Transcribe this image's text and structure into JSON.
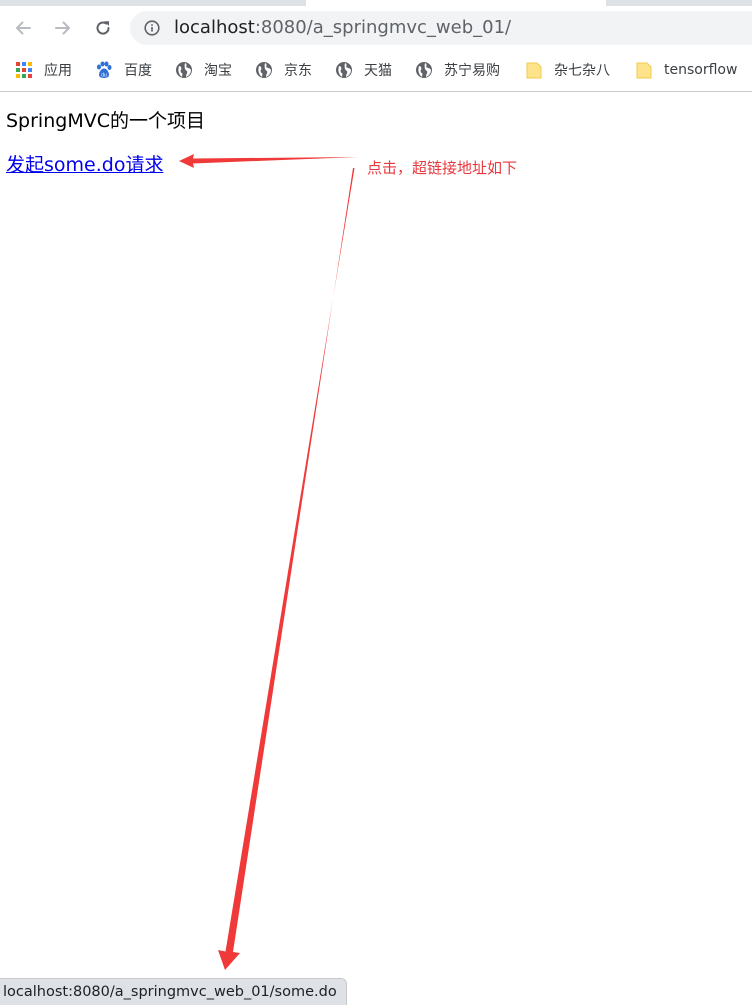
{
  "browser": {
    "url_host": "localhost",
    "url_rest": ":8080/a_springmvc_web_01/",
    "bookmarks": [
      {
        "label": "应用",
        "icon": "apps-grid-icon"
      },
      {
        "label": "百度",
        "icon": "baidu-paw-icon"
      },
      {
        "label": "淘宝",
        "icon": "globe-icon"
      },
      {
        "label": "京东",
        "icon": "globe-icon"
      },
      {
        "label": "天猫",
        "icon": "globe-icon"
      },
      {
        "label": "苏宁易购",
        "icon": "globe-icon"
      },
      {
        "label": "杂七杂八",
        "icon": "folder-icon"
      },
      {
        "label": "tensorflow",
        "icon": "folder-icon"
      }
    ]
  },
  "page": {
    "heading": "SpringMVC的一个项目",
    "link_text": "发起some.do请求"
  },
  "annotation": {
    "text": "点击，超链接地址如下",
    "color": "#e8383d"
  },
  "status_bar": {
    "text": "localhost:8080/a_springmvc_web_01/some.do"
  }
}
